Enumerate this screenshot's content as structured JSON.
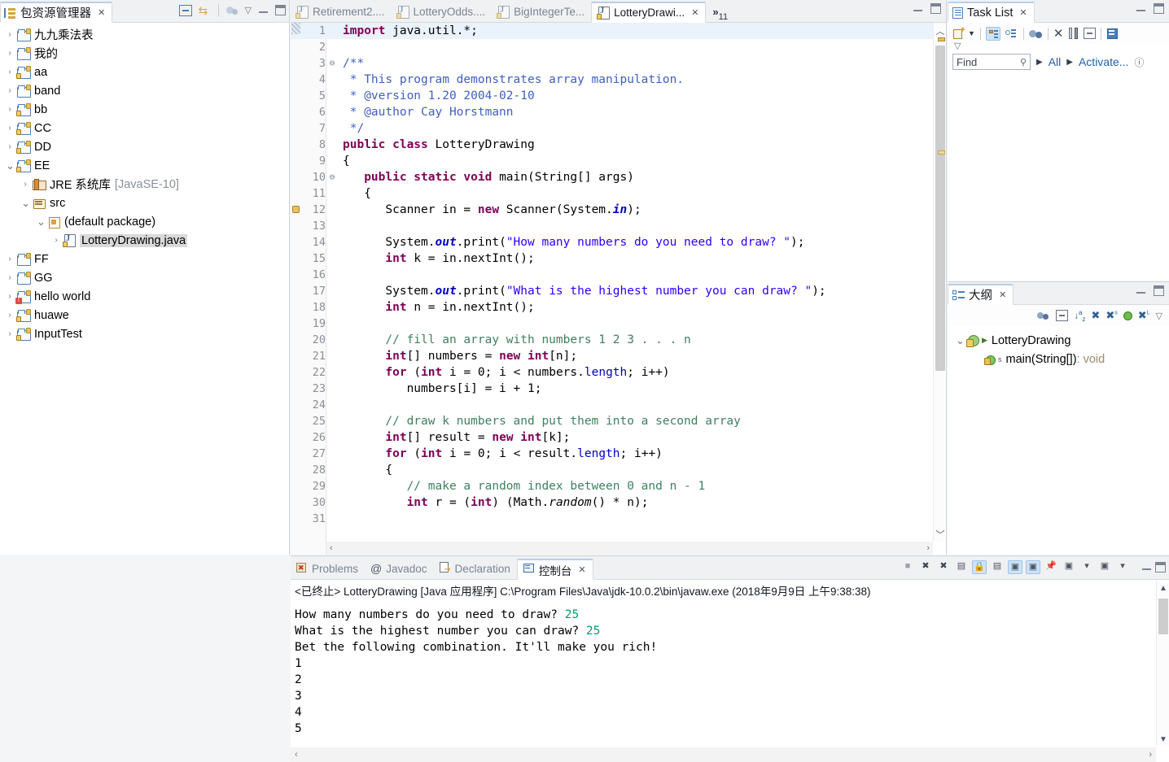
{
  "explorer": {
    "title": "包资源管理器",
    "close_label": "✕",
    "toolbar": [
      {
        "name": "collapse-all-icon",
        "glyph": "⊟"
      },
      {
        "name": "link-with-editor-icon",
        "glyph": "⇆"
      },
      {
        "name": "focus-on-active-task-icon",
        "glyph": "◴"
      },
      {
        "name": "view-menu-icon",
        "glyph": "▽"
      },
      {
        "name": "minimize-icon",
        "glyph": "—"
      },
      {
        "name": "maximize-icon",
        "glyph": "▢"
      }
    ],
    "tree": [
      {
        "label": "九九乘法表",
        "indent": 0,
        "icon": "project-folder",
        "expander": ">",
        "decorated": false
      },
      {
        "label": "我的",
        "indent": 0,
        "icon": "project-folder",
        "expander": ">",
        "decorated": false
      },
      {
        "label": "aa",
        "indent": 0,
        "icon": "project-folder-lock",
        "expander": ">",
        "decorated": true
      },
      {
        "label": "band",
        "indent": 0,
        "icon": "project-folder",
        "expander": ">",
        "decorated": false
      },
      {
        "label": "bb",
        "indent": 0,
        "icon": "project-folder-lock",
        "expander": ">",
        "decorated": true
      },
      {
        "label": "CC",
        "indent": 0,
        "icon": "project-folder-lock",
        "expander": ">",
        "decorated": true
      },
      {
        "label": "DD",
        "indent": 0,
        "icon": "project-folder-lock",
        "expander": ">",
        "decorated": true
      },
      {
        "label": "EE",
        "indent": 0,
        "icon": "project-folder-lock",
        "expander": "v",
        "decorated": true
      },
      {
        "label": "JRE 系统库",
        "suffix": "[JavaSE-10]",
        "indent": 1,
        "icon": "jre-library",
        "expander": ">"
      },
      {
        "label": "src",
        "indent": 1,
        "icon": "source-folder",
        "expander": "v"
      },
      {
        "label": "(default package)",
        "indent": 2,
        "icon": "package",
        "expander": "v"
      },
      {
        "label": "LotteryDrawing.java",
        "indent": 3,
        "icon": "java-file",
        "expander": ">",
        "selected": true
      },
      {
        "label": "FF",
        "indent": 0,
        "icon": "project-folder",
        "expander": ">",
        "decorated": false
      },
      {
        "label": "GG",
        "indent": 0,
        "icon": "project-folder",
        "expander": ">",
        "decorated": false
      },
      {
        "label": "hello world",
        "indent": 0,
        "icon": "project-folder-error",
        "expander": ">",
        "error": true
      },
      {
        "label": "huawe",
        "indent": 0,
        "icon": "project-folder-lock",
        "expander": ">",
        "decorated": true
      },
      {
        "label": "InputTest",
        "indent": 0,
        "icon": "project-folder-lock",
        "expander": ">",
        "decorated": true
      }
    ]
  },
  "editor": {
    "tabs": [
      {
        "label": "Retirement2....",
        "active": false
      },
      {
        "label": "LotteryOdds....",
        "active": false
      },
      {
        "label": "BigIntegerTe...",
        "active": false
      },
      {
        "label": "LotteryDrawi...",
        "active": true,
        "close": "✕"
      }
    ],
    "overflow_label": "11",
    "overflow_glyph": "»",
    "minimize_label": "—",
    "maximize_label": "▢",
    "scroll_up": "︿",
    "scroll_down": "﹀",
    "hscroll_left": "‹",
    "hscroll_right": "›",
    "lines": [
      {
        "n": "1",
        "fold": "",
        "current": true,
        "tokens": [
          {
            "t": "import",
            "c": "kw"
          },
          {
            "t": " java.util.*;",
            "c": ""
          }
        ]
      },
      {
        "n": "2",
        "fold": "",
        "tokens": []
      },
      {
        "n": "3",
        "fold": "⊖",
        "tokens": [
          {
            "t": "/**",
            "c": "jdoc"
          }
        ]
      },
      {
        "n": "4",
        "fold": "",
        "tokens": [
          {
            "t": " * This program demonstrates array manipulation.",
            "c": "jdoc"
          }
        ]
      },
      {
        "n": "5",
        "fold": "",
        "tokens": [
          {
            "t": " * @version 1.20 2004-02-10",
            "c": "jdoc"
          }
        ]
      },
      {
        "n": "6",
        "fold": "",
        "tokens": [
          {
            "t": " * @author Cay Horstmann",
            "c": "jdoc"
          }
        ]
      },
      {
        "n": "7",
        "fold": "",
        "tokens": [
          {
            "t": " */",
            "c": "jdoc"
          }
        ]
      },
      {
        "n": "8",
        "fold": "",
        "tokens": [
          {
            "t": "public class",
            "c": "kw"
          },
          {
            "t": " LotteryDrawing",
            "c": ""
          }
        ]
      },
      {
        "n": "9",
        "fold": "",
        "tokens": [
          {
            "t": "{",
            "c": ""
          }
        ]
      },
      {
        "n": "10",
        "fold": "⊖",
        "tokens": [
          {
            "t": "   ",
            "c": ""
          },
          {
            "t": "public static void",
            "c": "kw"
          },
          {
            "t": " main(String[] args)",
            "c": ""
          }
        ]
      },
      {
        "n": "11",
        "fold": "",
        "tokens": [
          {
            "t": "   {",
            "c": ""
          }
        ]
      },
      {
        "n": "12",
        "fold": "",
        "mark": "breakpoint-warning",
        "tokens": [
          {
            "t": "      Scanner in = ",
            "c": ""
          },
          {
            "t": "new",
            "c": "kw"
          },
          {
            "t": " Scanner(System.",
            "c": ""
          },
          {
            "t": "in",
            "c": "sfld"
          },
          {
            "t": ");",
            "c": ""
          }
        ]
      },
      {
        "n": "13",
        "fold": "",
        "tokens": []
      },
      {
        "n": "14",
        "fold": "",
        "tokens": [
          {
            "t": "      System.",
            "c": ""
          },
          {
            "t": "out",
            "c": "sfld"
          },
          {
            "t": ".print(",
            "c": ""
          },
          {
            "t": "\"How many numbers do you need to draw? \"",
            "c": "str"
          },
          {
            "t": ");",
            "c": ""
          }
        ]
      },
      {
        "n": "15",
        "fold": "",
        "tokens": [
          {
            "t": "      ",
            "c": ""
          },
          {
            "t": "int",
            "c": "kw"
          },
          {
            "t": " k = in.nextInt();",
            "c": ""
          }
        ]
      },
      {
        "n": "16",
        "fold": "",
        "tokens": []
      },
      {
        "n": "17",
        "fold": "",
        "tokens": [
          {
            "t": "      System.",
            "c": ""
          },
          {
            "t": "out",
            "c": "sfld"
          },
          {
            "t": ".print(",
            "c": ""
          },
          {
            "t": "\"What is the highest number you can draw? \"",
            "c": "str"
          },
          {
            "t": ");",
            "c": ""
          }
        ]
      },
      {
        "n": "18",
        "fold": "",
        "tokens": [
          {
            "t": "      ",
            "c": ""
          },
          {
            "t": "int",
            "c": "kw"
          },
          {
            "t": " n = in.nextInt();",
            "c": ""
          }
        ]
      },
      {
        "n": "19",
        "fold": "",
        "tokens": []
      },
      {
        "n": "20",
        "fold": "",
        "tokens": [
          {
            "t": "      ",
            "c": ""
          },
          {
            "t": "// fill an array with numbers 1 2 3 . . . n",
            "c": "cmt"
          }
        ]
      },
      {
        "n": "21",
        "fold": "",
        "tokens": [
          {
            "t": "      ",
            "c": ""
          },
          {
            "t": "int",
            "c": "kw"
          },
          {
            "t": "[] numbers = ",
            "c": ""
          },
          {
            "t": "new int",
            "c": "kw"
          },
          {
            "t": "[n];",
            "c": ""
          }
        ]
      },
      {
        "n": "22",
        "fold": "",
        "tokens": [
          {
            "t": "      ",
            "c": ""
          },
          {
            "t": "for",
            "c": "kw"
          },
          {
            "t": " (",
            "c": ""
          },
          {
            "t": "int",
            "c": "kw"
          },
          {
            "t": " i = 0; i < numbers.",
            "c": ""
          },
          {
            "t": "length",
            "c": "fld"
          },
          {
            "t": "; i++)",
            "c": ""
          }
        ]
      },
      {
        "n": "23",
        "fold": "",
        "tokens": [
          {
            "t": "         numbers[i] = i + 1;",
            "c": ""
          }
        ]
      },
      {
        "n": "24",
        "fold": "",
        "tokens": []
      },
      {
        "n": "25",
        "fold": "",
        "tokens": [
          {
            "t": "      ",
            "c": ""
          },
          {
            "t": "// draw k numbers and put them into a second array",
            "c": "cmt"
          }
        ]
      },
      {
        "n": "26",
        "fold": "",
        "tokens": [
          {
            "t": "      ",
            "c": ""
          },
          {
            "t": "int",
            "c": "kw"
          },
          {
            "t": "[] result = ",
            "c": ""
          },
          {
            "t": "new int",
            "c": "kw"
          },
          {
            "t": "[k];",
            "c": ""
          }
        ]
      },
      {
        "n": "27",
        "fold": "",
        "tokens": [
          {
            "t": "      ",
            "c": ""
          },
          {
            "t": "for",
            "c": "kw"
          },
          {
            "t": " (",
            "c": ""
          },
          {
            "t": "int",
            "c": "kw"
          },
          {
            "t": " i = 0; i < result.",
            "c": ""
          },
          {
            "t": "length",
            "c": "fld"
          },
          {
            "t": "; i++)",
            "c": ""
          }
        ]
      },
      {
        "n": "28",
        "fold": "",
        "tokens": [
          {
            "t": "      {",
            "c": ""
          }
        ]
      },
      {
        "n": "29",
        "fold": "",
        "tokens": [
          {
            "t": "         ",
            "c": ""
          },
          {
            "t": "// make a random index between 0 and n - 1",
            "c": "cmt"
          }
        ]
      },
      {
        "n": "30",
        "fold": "",
        "tokens": [
          {
            "t": "         ",
            "c": ""
          },
          {
            "t": "int",
            "c": "kw"
          },
          {
            "t": " r = (",
            "c": ""
          },
          {
            "t": "int",
            "c": "kw"
          },
          {
            "t": ") (Math.",
            "c": ""
          },
          {
            "t": "random",
            "c": "ital"
          },
          {
            "t": "() * n);",
            "c": ""
          }
        ]
      },
      {
        "n": "31",
        "fold": "",
        "tokens": []
      }
    ]
  },
  "tasklist": {
    "title": "Task List",
    "close_label": "✕",
    "minimize_label": "—",
    "maximize_label": "▢",
    "toolbar": [
      {
        "name": "new-task-icon",
        "glyph": "▣"
      },
      {
        "name": "new-task-dropdown-icon",
        "glyph": "▾"
      },
      {
        "name": "categorized-presentation-icon",
        "glyph": "▤",
        "active": true
      },
      {
        "name": "scheduled-presentation-icon",
        "glyph": "▤"
      },
      {
        "name": "focus-on-workweek-icon",
        "glyph": "◴"
      },
      {
        "name": "synchronize-changed-icon",
        "glyph": "✕"
      },
      {
        "name": "restore-tasks-icon",
        "glyph": "⇅"
      },
      {
        "name": "collapse-all-icon",
        "glyph": "⊟"
      },
      {
        "name": "view-menu-icon",
        "glyph": "▤"
      },
      {
        "name": "dropdown-menu-icon",
        "glyph": "▽"
      }
    ],
    "find_placeholder": "Find",
    "search_icon": "🔍",
    "filter_all": "All",
    "filter_activate": "Activate...",
    "help_icon": "?"
  },
  "outline": {
    "title": "大纲",
    "close_label": "✕",
    "minimize_label": "—",
    "maximize_label": "▢",
    "toolbar": [
      {
        "name": "focus-on-active-task-icon",
        "glyph": "◴"
      },
      {
        "name": "collapse-all-icon",
        "glyph": "⊟"
      },
      {
        "name": "sort-icon",
        "glyph": "↓ᴬz"
      },
      {
        "name": "hide-fields-icon",
        "glyph": "✎"
      },
      {
        "name": "hide-static-icon",
        "glyph": "✎ˢ"
      },
      {
        "name": "hide-nonpublic-icon",
        "glyph": "●"
      },
      {
        "name": "hide-local-types-icon",
        "glyph": "✎ᴸ"
      },
      {
        "name": "view-menu-icon",
        "glyph": "▽"
      }
    ],
    "items": [
      {
        "label": "LotteryDrawing",
        "indent": 0,
        "icon": "class",
        "expander": "v"
      },
      {
        "label": "main(String[])",
        "suffix": " : void",
        "indent": 1,
        "icon": "method",
        "expander": ""
      }
    ]
  },
  "console": {
    "tabs": [
      {
        "label": "Problems",
        "icon": "problems-icon",
        "active": false
      },
      {
        "label": "Javadoc",
        "icon": "javadoc-icon",
        "active": false
      },
      {
        "label": "Declaration",
        "icon": "declaration-icon",
        "active": false
      },
      {
        "label": "控制台",
        "icon": "console-icon",
        "active": true,
        "close": "✕"
      }
    ],
    "toolbar": [
      {
        "name": "terminate-icon",
        "glyph": "■"
      },
      {
        "name": "remove-launch-icon",
        "glyph": "✖"
      },
      {
        "name": "remove-all-terminated-icon",
        "glyph": "✖"
      },
      {
        "name": "clear-console-icon",
        "glyph": "▤"
      },
      {
        "name": "scroll-lock-icon",
        "glyph": "🔒",
        "active": true
      },
      {
        "name": "word-wrap-icon",
        "glyph": "▤"
      },
      {
        "name": "show-console-on-output-icon",
        "glyph": "▣",
        "active": true
      },
      {
        "name": "show-console-on-error-icon",
        "glyph": "▣",
        "active": true
      },
      {
        "name": "pin-console-icon",
        "glyph": "📌"
      },
      {
        "name": "display-selected-console-icon",
        "glyph": "▣"
      },
      {
        "name": "display-console-dropdown-icon",
        "glyph": "▾"
      },
      {
        "name": "open-console-icon",
        "glyph": "▣"
      },
      {
        "name": "open-console-dropdown-icon",
        "glyph": "▾"
      },
      {
        "name": "minimize-icon",
        "glyph": "—"
      },
      {
        "name": "maximize-icon",
        "glyph": "▢"
      }
    ],
    "launch_config": "<已终止> LotteryDrawing [Java 应用程序] C:\\Program Files\\Java\\jdk-10.0.2\\bin\\javaw.exe  (2018年9月9日 上午9:38:38)",
    "output": [
      {
        "text": "How many numbers do you need to draw? ",
        "value": "25"
      },
      {
        "text": "What is the highest number you can draw? ",
        "value": "25"
      },
      {
        "text": "Bet the following combination. It'll make you rich!",
        "value": ""
      },
      {
        "text": "1",
        "value": ""
      },
      {
        "text": "2",
        "value": ""
      },
      {
        "text": "3",
        "value": ""
      },
      {
        "text": "4",
        "value": ""
      },
      {
        "text": "5",
        "value": ""
      }
    ],
    "hscroll_left": "‹",
    "hscroll_right": "›"
  },
  "colors": {
    "keyword": "#7f0055",
    "string": "#2a00ff",
    "comment": "#3f7f5f",
    "javadoc": "#3f5fbf",
    "field": "#0000c0",
    "console_input": "#00a06a",
    "link": "#1f5fa8",
    "selection": "#d9d9d9"
  }
}
